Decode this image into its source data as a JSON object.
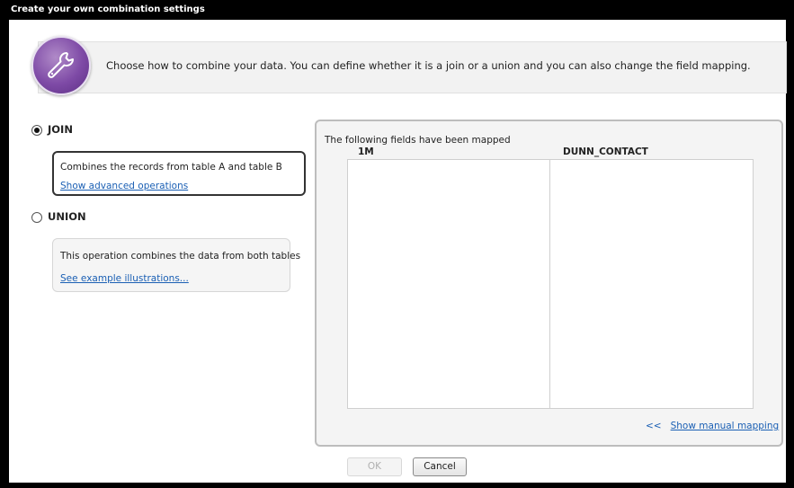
{
  "window": {
    "title": "Create your own combination settings"
  },
  "header": {
    "icon": "wrench-icon",
    "description": "Choose how to combine your data. You can define whether it is a join or a union and you can also change the field mapping."
  },
  "options": {
    "join": {
      "label": "JOIN",
      "selected": true,
      "description": "Combines the records from table A and table B",
      "link": "Show advanced operations"
    },
    "union": {
      "label": "UNION",
      "selected": false,
      "description": "This operation combines the data from both tables",
      "link": "See example illustrations..."
    }
  },
  "mapping": {
    "caption": "The following fields have been mapped",
    "columns": [
      "1M",
      "DUNN_CONTACT"
    ],
    "rows": [],
    "manual_link_arrows": "<<",
    "manual_link": "Show manual mapping"
  },
  "buttons": {
    "ok": "OK",
    "ok_enabled": false,
    "cancel": "Cancel"
  },
  "colors": {
    "title_bar": "#000000",
    "link": "#1a5fb4",
    "icon_purple": "#7e4aa6"
  }
}
